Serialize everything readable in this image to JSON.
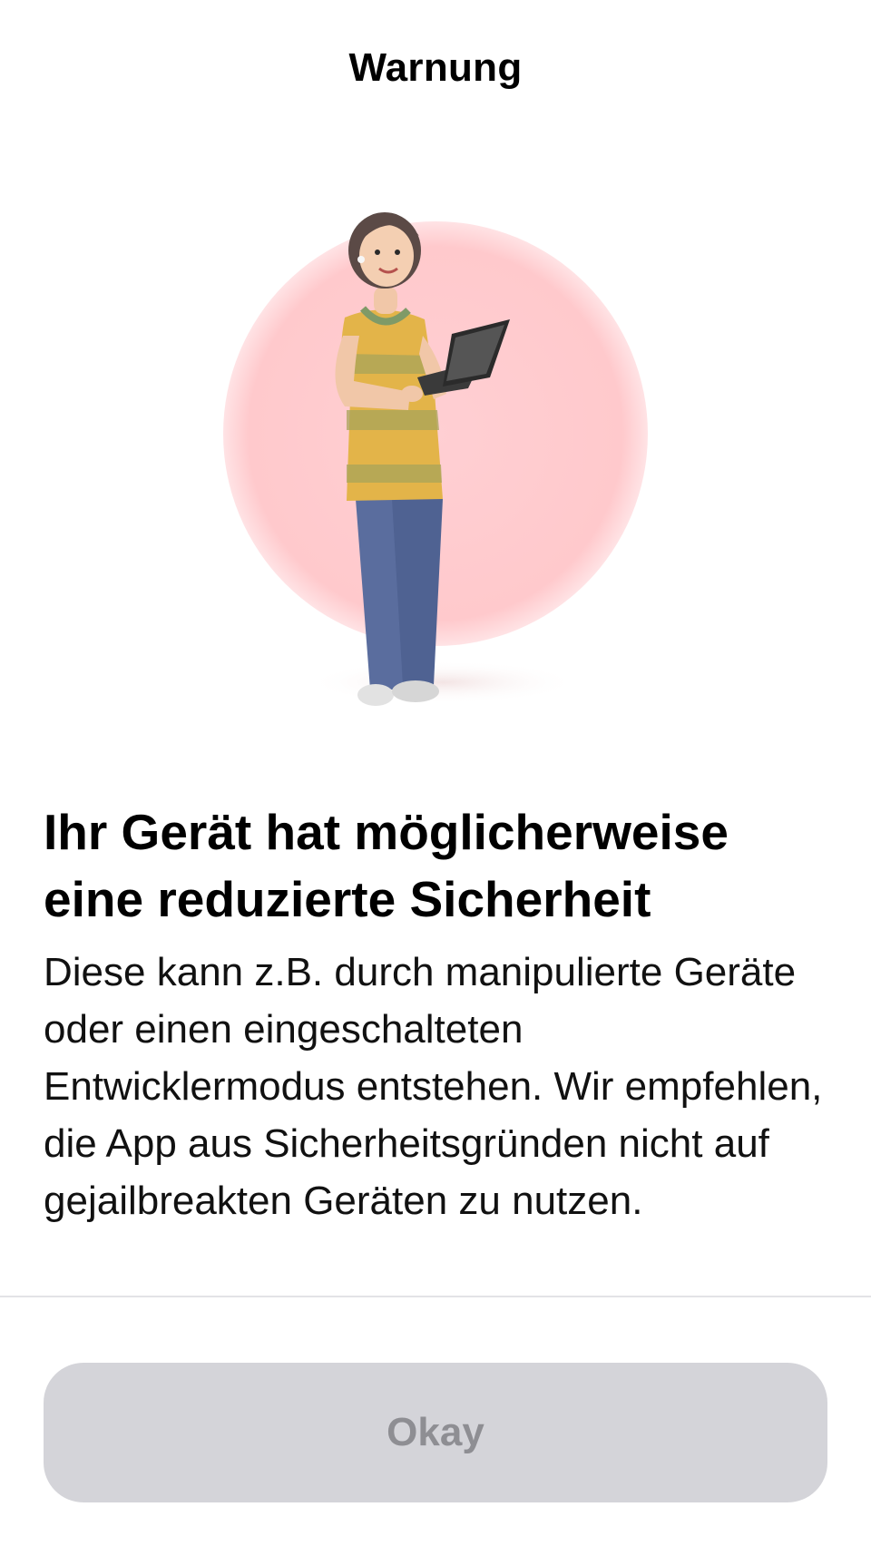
{
  "header": {
    "title": "Warnung"
  },
  "illustration": {
    "icon": "woman-with-laptop-illustration",
    "accent_color": "#ffc9cc"
  },
  "content": {
    "headline": "Ihr Gerät hat möglicherweise eine reduzierte Sicherheit",
    "body": "Diese kann z.B. durch manipulierte Geräte oder einen eingeschalteten Entwicklermodus entstehen. Wir empfehlen, die App aus Sicherheitsgründen nicht auf gejailbreakten Geräten zu nutzen."
  },
  "footer": {
    "okay_label": "Okay",
    "button_color": "#d4d4d9",
    "button_text_color": "#8e8e93"
  }
}
